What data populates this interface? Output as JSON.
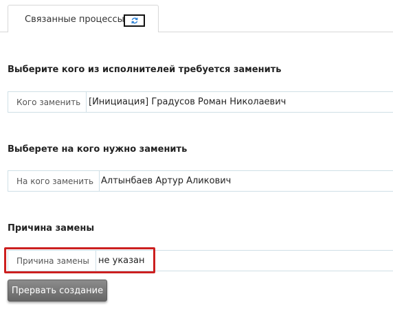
{
  "tabs": {
    "active_label": "Связанные процессы",
    "refresh_icon": "refresh-icon"
  },
  "sections": {
    "replace_who": {
      "heading": "Выберите кого из исполнителей требуется заменить",
      "field_label": "Кого заменить",
      "field_value": "[Инициация] Градусов Роман Николаевич"
    },
    "replace_with": {
      "heading": "Выберете на кого нужно заменить",
      "field_label": "На кого заменить",
      "field_value": "Алтынбаев Артур Аликович"
    },
    "reason": {
      "heading": "Причина замены",
      "field_label": "Причина замены",
      "field_value": "не указан"
    }
  },
  "actions": {
    "abort_label": "Прервать создание"
  },
  "colors": {
    "highlight": "#cc1f1f",
    "field_border": "#cfdfe6",
    "button_bg": "#777777"
  }
}
